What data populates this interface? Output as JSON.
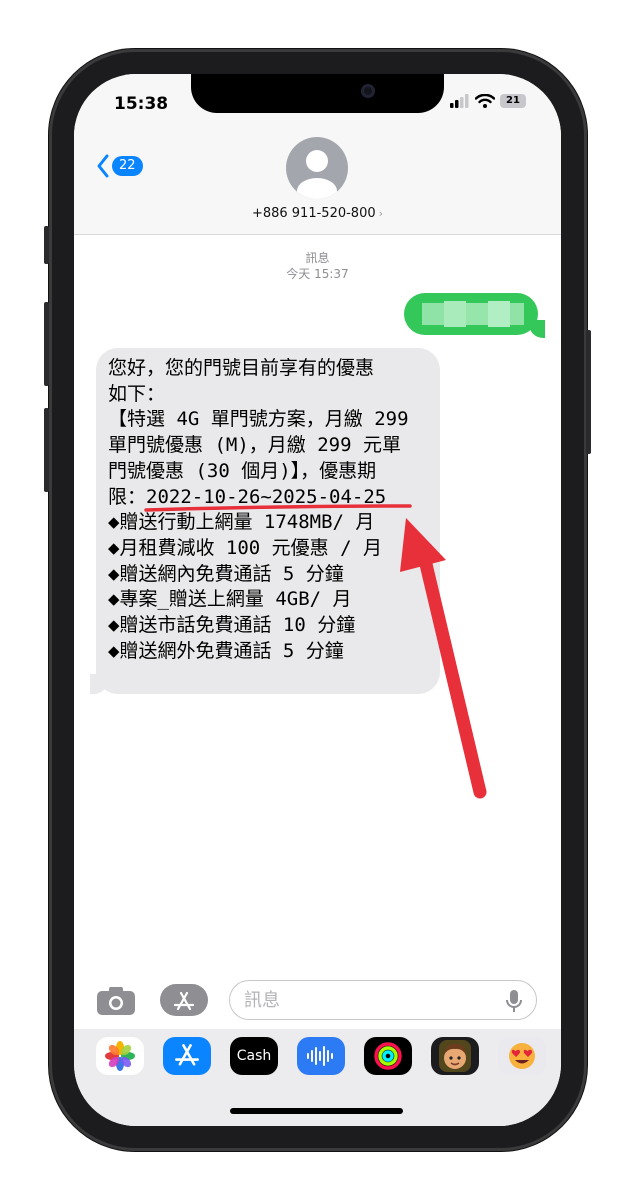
{
  "status_bar": {
    "time": "15:38",
    "battery": "21"
  },
  "header": {
    "back_count": "22",
    "contact": "+886 911-520-800",
    "contact_chevron": "›"
  },
  "conversation": {
    "service": "訊息",
    "timestamp": "今天 15:37"
  },
  "received_message": {
    "text": "您好，您的門號目前享有的優惠\n如下：\n【特選 4G 單門號方案，月繳 299\n單門號優惠 (M)，月繳 299 元單\n門號優惠 (30 個月)】，優惠期\n限：2022-10-26~2025-04-25\n◆贈送行動上網量 1748MB/ 月\n◆月租費減收 100 元優惠 / 月\n◆贈送網內免費通話 5 分鐘\n◆專案_贈送上網量 4GB/ 月\n◆贈送市話免費通話 10 分鐘\n◆贈送網外免費通話 5 分鐘"
  },
  "input": {
    "placeholder": "訊息"
  },
  "app_drawer": {
    "cash_label": "Cash",
    "apple_glyph": ""
  },
  "colors": {
    "accent_blue": "#0a84ff",
    "sent_bubble": "#34c759",
    "received_bubble": "#e9e9eb",
    "annotation_red": "#e8303a"
  }
}
